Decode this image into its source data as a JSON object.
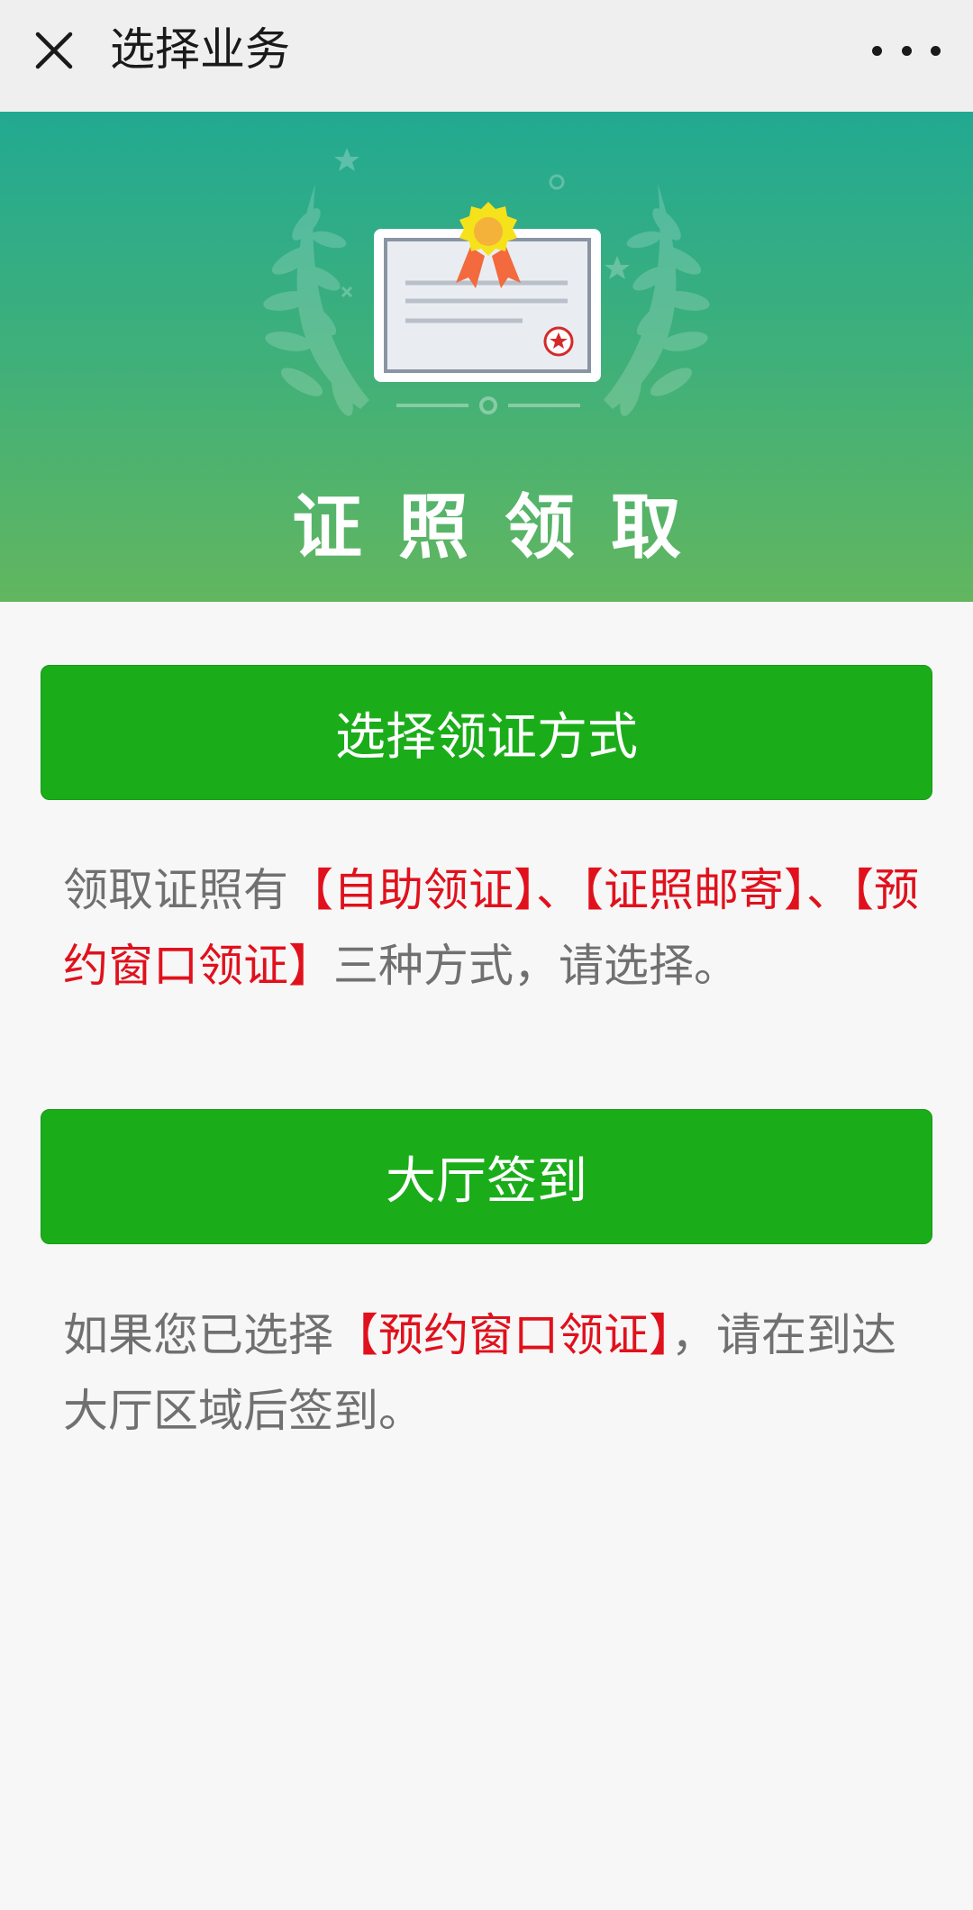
{
  "topbar": {
    "title": "选择业务",
    "close_icon": "close-icon",
    "more_icon": "more-icon"
  },
  "banner": {
    "title": "证照领取",
    "illustration": "certificate-with-laurel-icon"
  },
  "buttons": {
    "method_label": "选择领证方式",
    "checkin_label": "大厅签到"
  },
  "desc1": {
    "prefix": "领取证照有",
    "opt1": "【自助领证】",
    "sep1": "、",
    "opt2": "【证照邮寄】",
    "sep2": "、",
    "opt3": "【预约窗口领证】",
    "suffix": "三种方式，请选择。"
  },
  "desc2": {
    "prefix": "如果您已选择",
    "highlight": "【预约窗口领证】",
    "suffix": "，请在到达大厅区域后签到。"
  },
  "colors": {
    "primary_green": "#1aad19",
    "highlight_red": "#e0111c",
    "banner_top": "#22a992",
    "banner_bottom": "#62b65f"
  }
}
